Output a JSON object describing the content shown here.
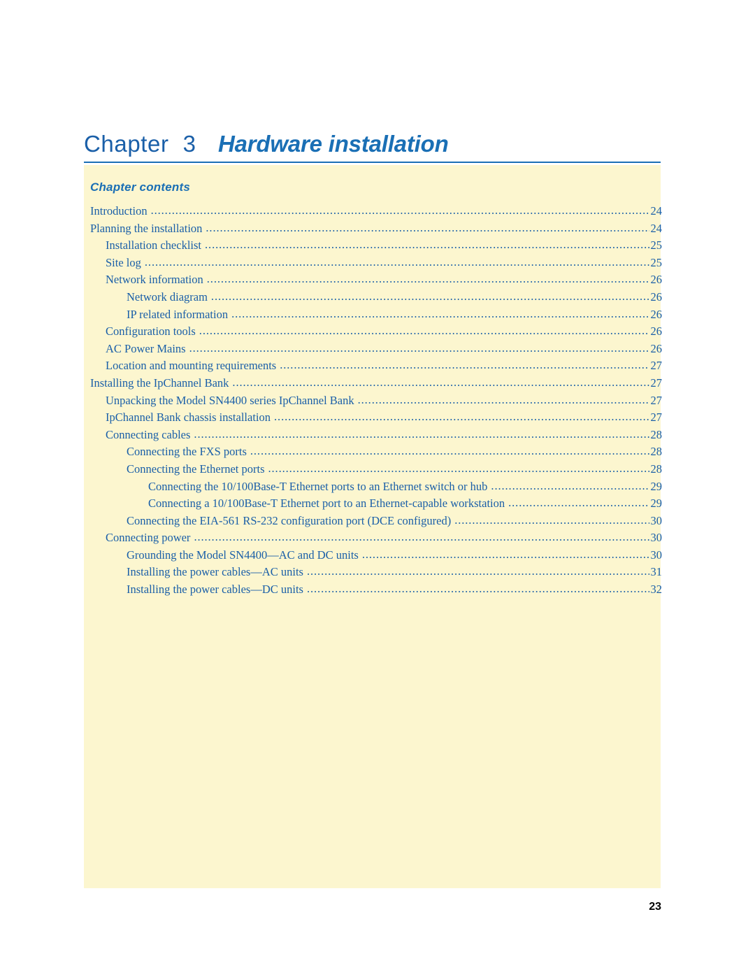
{
  "header": {
    "chapter_word": "Chapter",
    "chapter_number": "3",
    "chapter_title": "Hardware installation"
  },
  "contents": {
    "label": "Chapter contents"
  },
  "toc": {
    "entries": [
      {
        "label": "Introduction",
        "page": "24",
        "level": 0
      },
      {
        "label": "Planning the installation",
        "page": "24",
        "level": 0
      },
      {
        "label": "Installation checklist",
        "page": "25",
        "level": 1
      },
      {
        "label": "Site log",
        "page": "25",
        "level": 1
      },
      {
        "label": "Network information",
        "page": "26",
        "level": 1
      },
      {
        "label": "Network diagram",
        "page": "26",
        "level": 2
      },
      {
        "label": "IP related information",
        "page": "26",
        "level": 2
      },
      {
        "label": "Configuration tools",
        "page": "26",
        "level": 1
      },
      {
        "label": "AC Power Mains",
        "page": "26",
        "level": 1
      },
      {
        "label": "Location and mounting requirements",
        "page": "27",
        "level": 1
      },
      {
        "label": "Installing the IpChannel Bank",
        "page": "27",
        "level": 0
      },
      {
        "label": "Unpacking the Model SN4400 series IpChannel Bank",
        "page": "27",
        "level": 1
      },
      {
        "label": "IpChannel Bank chassis installation",
        "page": "27",
        "level": 1
      },
      {
        "label": "Connecting cables",
        "page": "28",
        "level": 1
      },
      {
        "label": "Connecting the FXS ports",
        "page": "28",
        "level": 2
      },
      {
        "label": "Connecting the Ethernet ports",
        "page": "28",
        "level": 2
      },
      {
        "label": "Connecting the 10/100Base-T Ethernet ports to an Ethernet switch or hub",
        "page": "29",
        "level": 3
      },
      {
        "label": "Connecting a 10/100Base-T Ethernet port to an Ethernet-capable workstation",
        "page": "29",
        "level": 3
      },
      {
        "label": "Connecting the EIA-561 RS-232 configuration port (DCE configured)",
        "page": "30",
        "level": 2
      },
      {
        "label": "Connecting power",
        "page": "30",
        "level": 1
      },
      {
        "label": "Grounding the Model SN4400—AC and DC units",
        "page": "30",
        "level": 2
      },
      {
        "label": "Installing the power cables—AC units",
        "page": "31",
        "level": 2
      },
      {
        "label": "Installing the power cables—DC units",
        "page": "32",
        "level": 2
      }
    ]
  },
  "footer": {
    "page_number": "23"
  },
  "colors": {
    "accent": "#1a6fb5",
    "panel": "#fcf6cf",
    "text": "#1a5fa8"
  }
}
